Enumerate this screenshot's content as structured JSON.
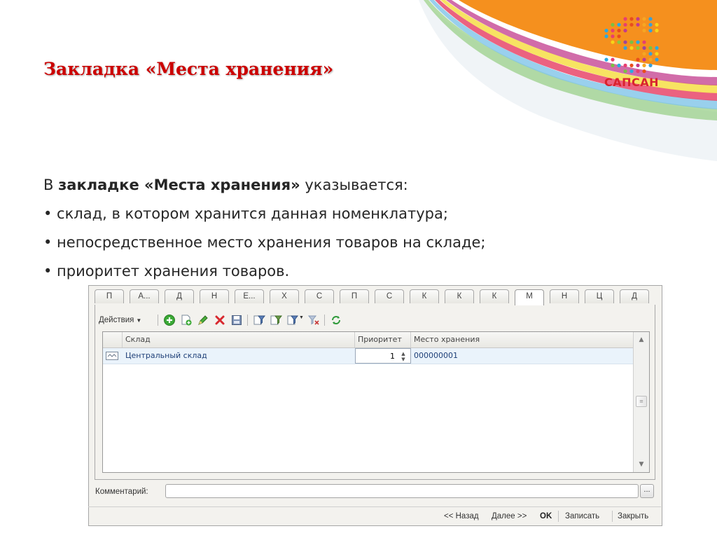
{
  "slide": {
    "title": "Закладка «Места хранения»",
    "intro_prefix": "В",
    "intro_bold": "закладке «Места хранения»",
    "intro_suffix": "указывается:",
    "bullets": [
      "• склад, в котором хранится данная номенклатура;",
      "• непосредственное место хранения товаров на складе;",
      "• приоритет хранения товаров."
    ]
  },
  "logo": {
    "text": "САПСАН",
    "color": "#d9232e"
  },
  "form": {
    "tabs": [
      "П",
      "А...",
      "Д",
      "Н",
      "Е...",
      "Х",
      "С",
      "П",
      "С",
      "К",
      "К",
      "К",
      "М",
      "Н",
      "Ц",
      "Д"
    ],
    "active_tab_index": 12,
    "toolbar": {
      "actions_label": "Действия",
      "icons": [
        "add-icon",
        "copy-icon",
        "edit-icon",
        "delete-icon",
        "save-icon",
        "filter-icon",
        "filter-by-value-icon",
        "filter-history-icon",
        "filter-clear-icon",
        "refresh-icon"
      ]
    },
    "table": {
      "columns": [
        "Склад",
        "Приоритет",
        "Место хранения"
      ],
      "rows": [
        {
          "warehouse": "Центральный склад",
          "priority": "1",
          "location": "000000001"
        }
      ]
    },
    "comment": {
      "label": "Комментарий:",
      "value": "",
      "button": "..."
    },
    "bottom": {
      "back": "<< Назад",
      "next": "Далее >>",
      "ok": "OK",
      "save": "Записать",
      "close": "Закрыть"
    }
  },
  "colors": {
    "title": "#cc0000",
    "orange": "#f5901e",
    "selected_row": "#eaf3fb"
  }
}
